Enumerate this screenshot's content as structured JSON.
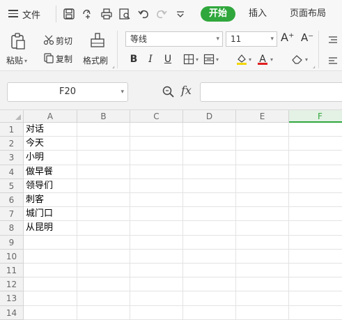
{
  "menubar": {
    "file_label": "文件",
    "tabs": [
      {
        "label": "开始",
        "active": true
      },
      {
        "label": "插入",
        "active": false
      },
      {
        "label": "页面布局",
        "active": false
      }
    ],
    "quick_access_icons": [
      "save-icon",
      "format-painter-icon",
      "print-icon",
      "print-preview-icon",
      "undo-icon",
      "redo-icon",
      "customize-icon"
    ]
  },
  "ribbon": {
    "paste_label": "粘贴",
    "cut_label": "剪切",
    "copy_label": "复制",
    "format_painter_label": "格式刷",
    "font_name": "等线",
    "font_size": "11",
    "increase_font_label": "A⁺",
    "decrease_font_label": "A⁻",
    "bold_label": "B",
    "italic_label": "I",
    "underline_label": "U",
    "font_color_label": "A"
  },
  "formula_bar": {
    "name_box": "F20",
    "fx_label": "fx",
    "formula_value": ""
  },
  "accent_color": "#2fa73c",
  "sheet": {
    "columns": [
      "A",
      "B",
      "C",
      "D",
      "E",
      "F"
    ],
    "selected_column": "F",
    "rows": [
      {
        "num": "1",
        "A": "对话"
      },
      {
        "num": "2",
        "A": "今天"
      },
      {
        "num": "3",
        "A": "小明"
      },
      {
        "num": "4",
        "A": "做早餐"
      },
      {
        "num": "5",
        "A": "领导们"
      },
      {
        "num": "6",
        "A": "刺客"
      },
      {
        "num": "7",
        "A": "城门口"
      },
      {
        "num": "8",
        "A": "从昆明"
      },
      {
        "num": "9",
        "A": ""
      },
      {
        "num": "10",
        "A": ""
      },
      {
        "num": "11",
        "A": ""
      },
      {
        "num": "12",
        "A": ""
      },
      {
        "num": "13",
        "A": ""
      },
      {
        "num": "14",
        "A": ""
      }
    ]
  }
}
